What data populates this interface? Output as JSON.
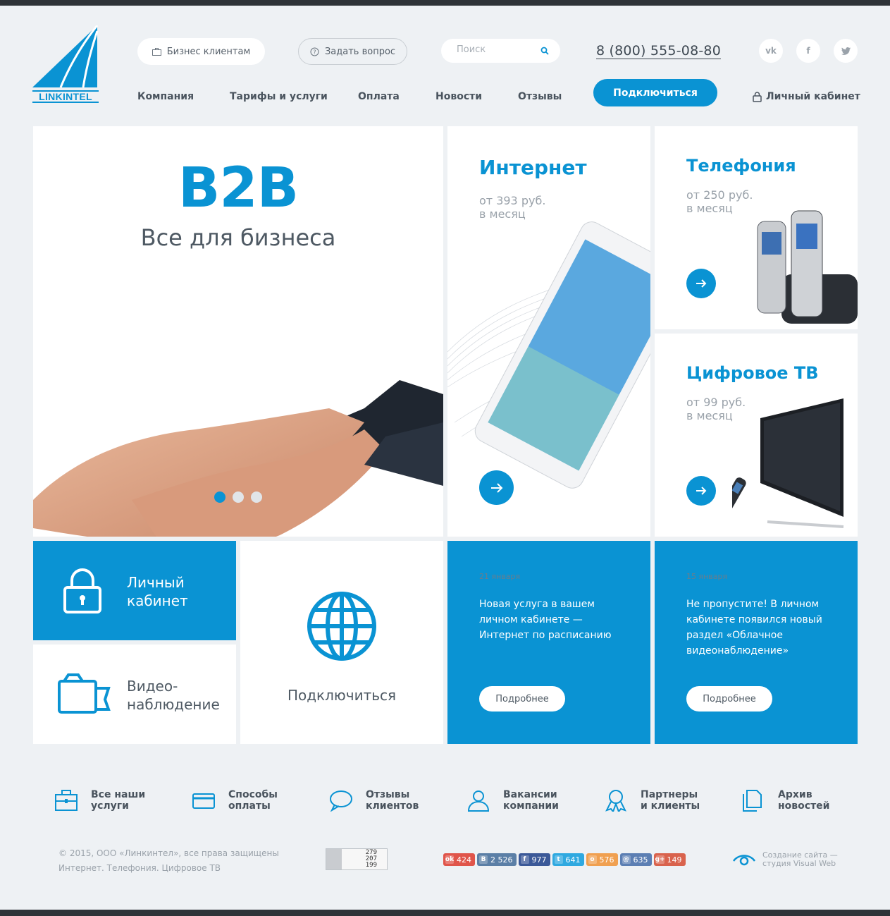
{
  "brand": {
    "logo_text": "LINKINTEL"
  },
  "header": {
    "business_label": "Бизнес клиентам",
    "ask_label": "Задать вопрос",
    "search_placeholder": "Поиск",
    "phone": "8 (800) 555-08-80",
    "social": [
      "vk-icon",
      "facebook-icon",
      "twitter-icon"
    ],
    "nav": [
      "Компания",
      "Тарифы и услуги",
      "Оплата",
      "Новости",
      "Отзывы"
    ],
    "connect_label": "Подключиться",
    "cabinet_label": "Личный кабинет"
  },
  "hero": {
    "title": "B2B",
    "subtitle": "Все для бизнеса",
    "slides": 3,
    "active_slide": 1
  },
  "services": [
    {
      "title": "Интернет",
      "price": "от 393 руб.",
      "period": "в месяц"
    },
    {
      "title": "Телефония",
      "price": "от 250 руб.",
      "period": "в месяц"
    },
    {
      "title": "Цифровое ТВ",
      "price": "от 99 руб.",
      "period": "в месяц"
    }
  ],
  "tiles": {
    "cabinet": "Личный\nкабинет",
    "video": "Видео-\nнаблюдение",
    "connect": "Подключиться"
  },
  "news": [
    {
      "date": "21 января",
      "text": "Новая услуга в вашем личном кабинете — Интернет по расписанию",
      "button": "Подробнее"
    },
    {
      "date": "15 января",
      "text": "Не пропустите! В личном кабинете появился новый раздел «Облачное видеонаблюдение»",
      "button": "Подробнее"
    }
  ],
  "footer_links": [
    {
      "label": "Все наши\nуслуги",
      "icon": "briefcase-icon"
    },
    {
      "label": "Способы\nоплаты",
      "icon": "credit-card-icon"
    },
    {
      "label": "Отзывы\nклиентов",
      "icon": "speech-bubble-icon"
    },
    {
      "label": "Вакансии\nкомпании",
      "icon": "person-icon"
    },
    {
      "label": "Партнеры\nи клиенты",
      "icon": "award-icon"
    },
    {
      "label": "Архив\nновостей",
      "icon": "documents-icon"
    }
  ],
  "footer": {
    "copyright": "© 2015, ООО «Линкинтел», все права защищены",
    "tagline": "Интернет. Телефония. Цифровое ТВ",
    "counter": [
      "279",
      "207",
      "199"
    ],
    "shares": [
      {
        "glyph": "ok",
        "count": "424",
        "color": "#e0554a"
      },
      {
        "glyph": "B",
        "count": "2 526",
        "color": "#5b7fa6"
      },
      {
        "glyph": "f",
        "count": "977",
        "color": "#3b5998"
      },
      {
        "glyph": "t",
        "count": "641",
        "color": "#2fa9e0"
      },
      {
        "glyph": "o",
        "count": "576",
        "color": "#f0a050"
      },
      {
        "glyph": "@",
        "count": "635",
        "color": "#5c7fb3"
      },
      {
        "glyph": "g+",
        "count": "149",
        "color": "#d9634d"
      }
    ],
    "credit": "Создание сайта —\nстудия Visual Web"
  },
  "colors": {
    "accent": "#0a93d3",
    "background": "#eef1f4",
    "dark": "#2f3338"
  }
}
